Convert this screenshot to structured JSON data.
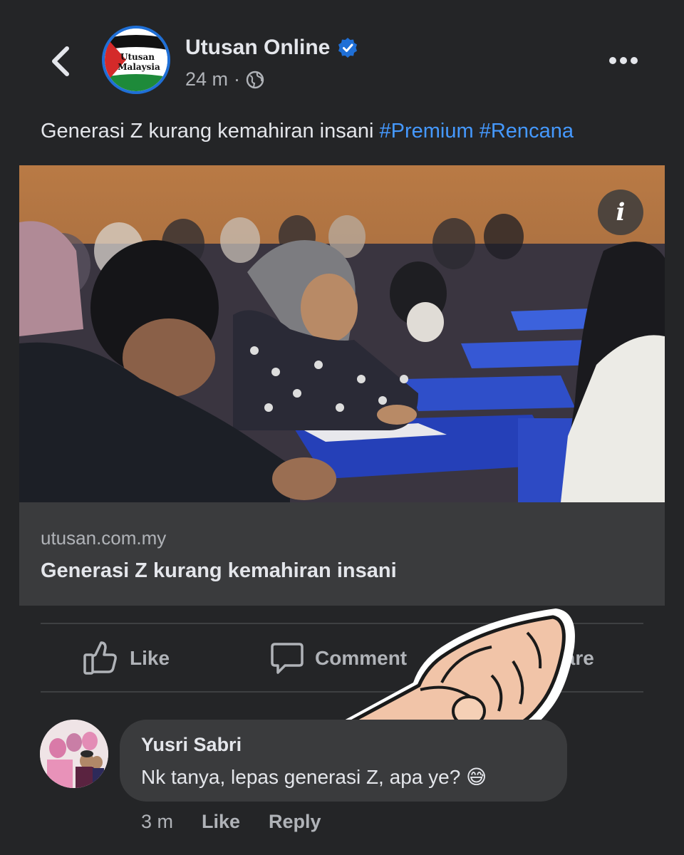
{
  "header": {
    "page_name": "Utusan Online",
    "avatar_text_line1": "Utusan",
    "avatar_text_line2": "Malaysia",
    "time_ago": "24 m",
    "separator": "·"
  },
  "post": {
    "text": "Generasi Z kurang kemahiran insani ",
    "hashtags": [
      "#Premium",
      "#Rencana"
    ]
  },
  "link_card": {
    "domain": "utusan.com.my",
    "title": "Generasi Z kurang kemahiran insani",
    "info_label": "i"
  },
  "actions": {
    "like_label": "Like",
    "comment_label": "Comment",
    "share_label": "Share"
  },
  "comment": {
    "author": "Yusri Sabri",
    "text": "Nk tanya, lepas generasi Z, apa ye? 😅",
    "time_ago": "3 m",
    "like_label": "Like",
    "reply_label": "Reply"
  },
  "colors": {
    "background": "#242527",
    "hashtag": "#4599ff",
    "verified": "#1f6fd6"
  }
}
